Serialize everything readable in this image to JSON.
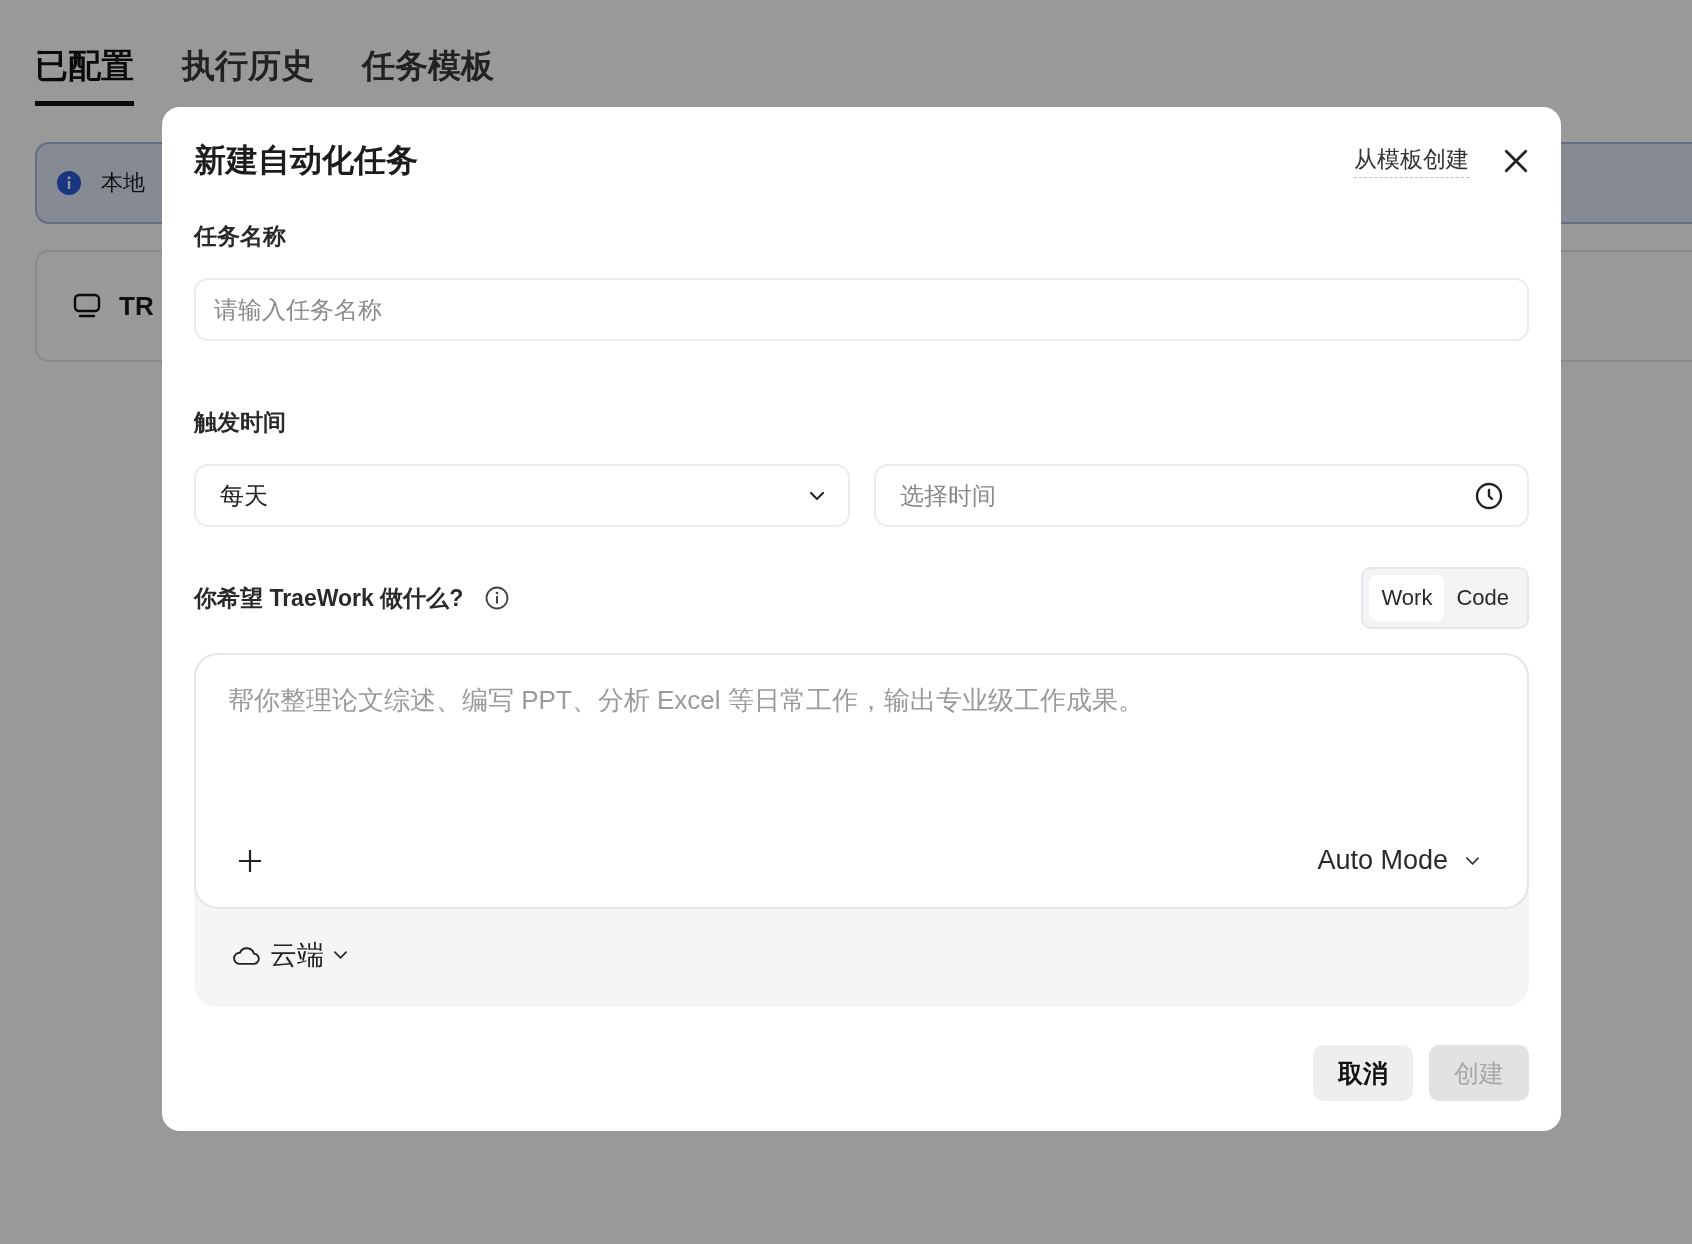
{
  "tabs": [
    {
      "label": "已配置",
      "selected": true
    },
    {
      "label": "执行历史",
      "selected": false
    },
    {
      "label": "任务模板",
      "selected": false
    }
  ],
  "info_banner": {
    "text": "本地"
  },
  "task_card": {
    "title": "TR"
  },
  "dialog": {
    "title": "新建自动化任务",
    "template_link": "从模板创建",
    "name_field": {
      "label": "任务名称",
      "placeholder": "请输入任务名称"
    },
    "trigger": {
      "label": "触发时间",
      "frequency": "每天",
      "time_placeholder": "选择时间"
    },
    "prompt": {
      "label": "你希望 TraeWork 做什么?",
      "modes": [
        {
          "label": "Work",
          "selected": true
        },
        {
          "label": "Code",
          "selected": false
        }
      ],
      "placeholder": "帮你整理论文综述、编写 PPT、分析 Excel 等日常工作，输出专业级工作成果。",
      "model": "Auto Mode",
      "environment": "云端"
    },
    "buttons": [
      {
        "label": "取消",
        "disabled": false
      },
      {
        "label": "创建",
        "disabled": true
      }
    ]
  }
}
